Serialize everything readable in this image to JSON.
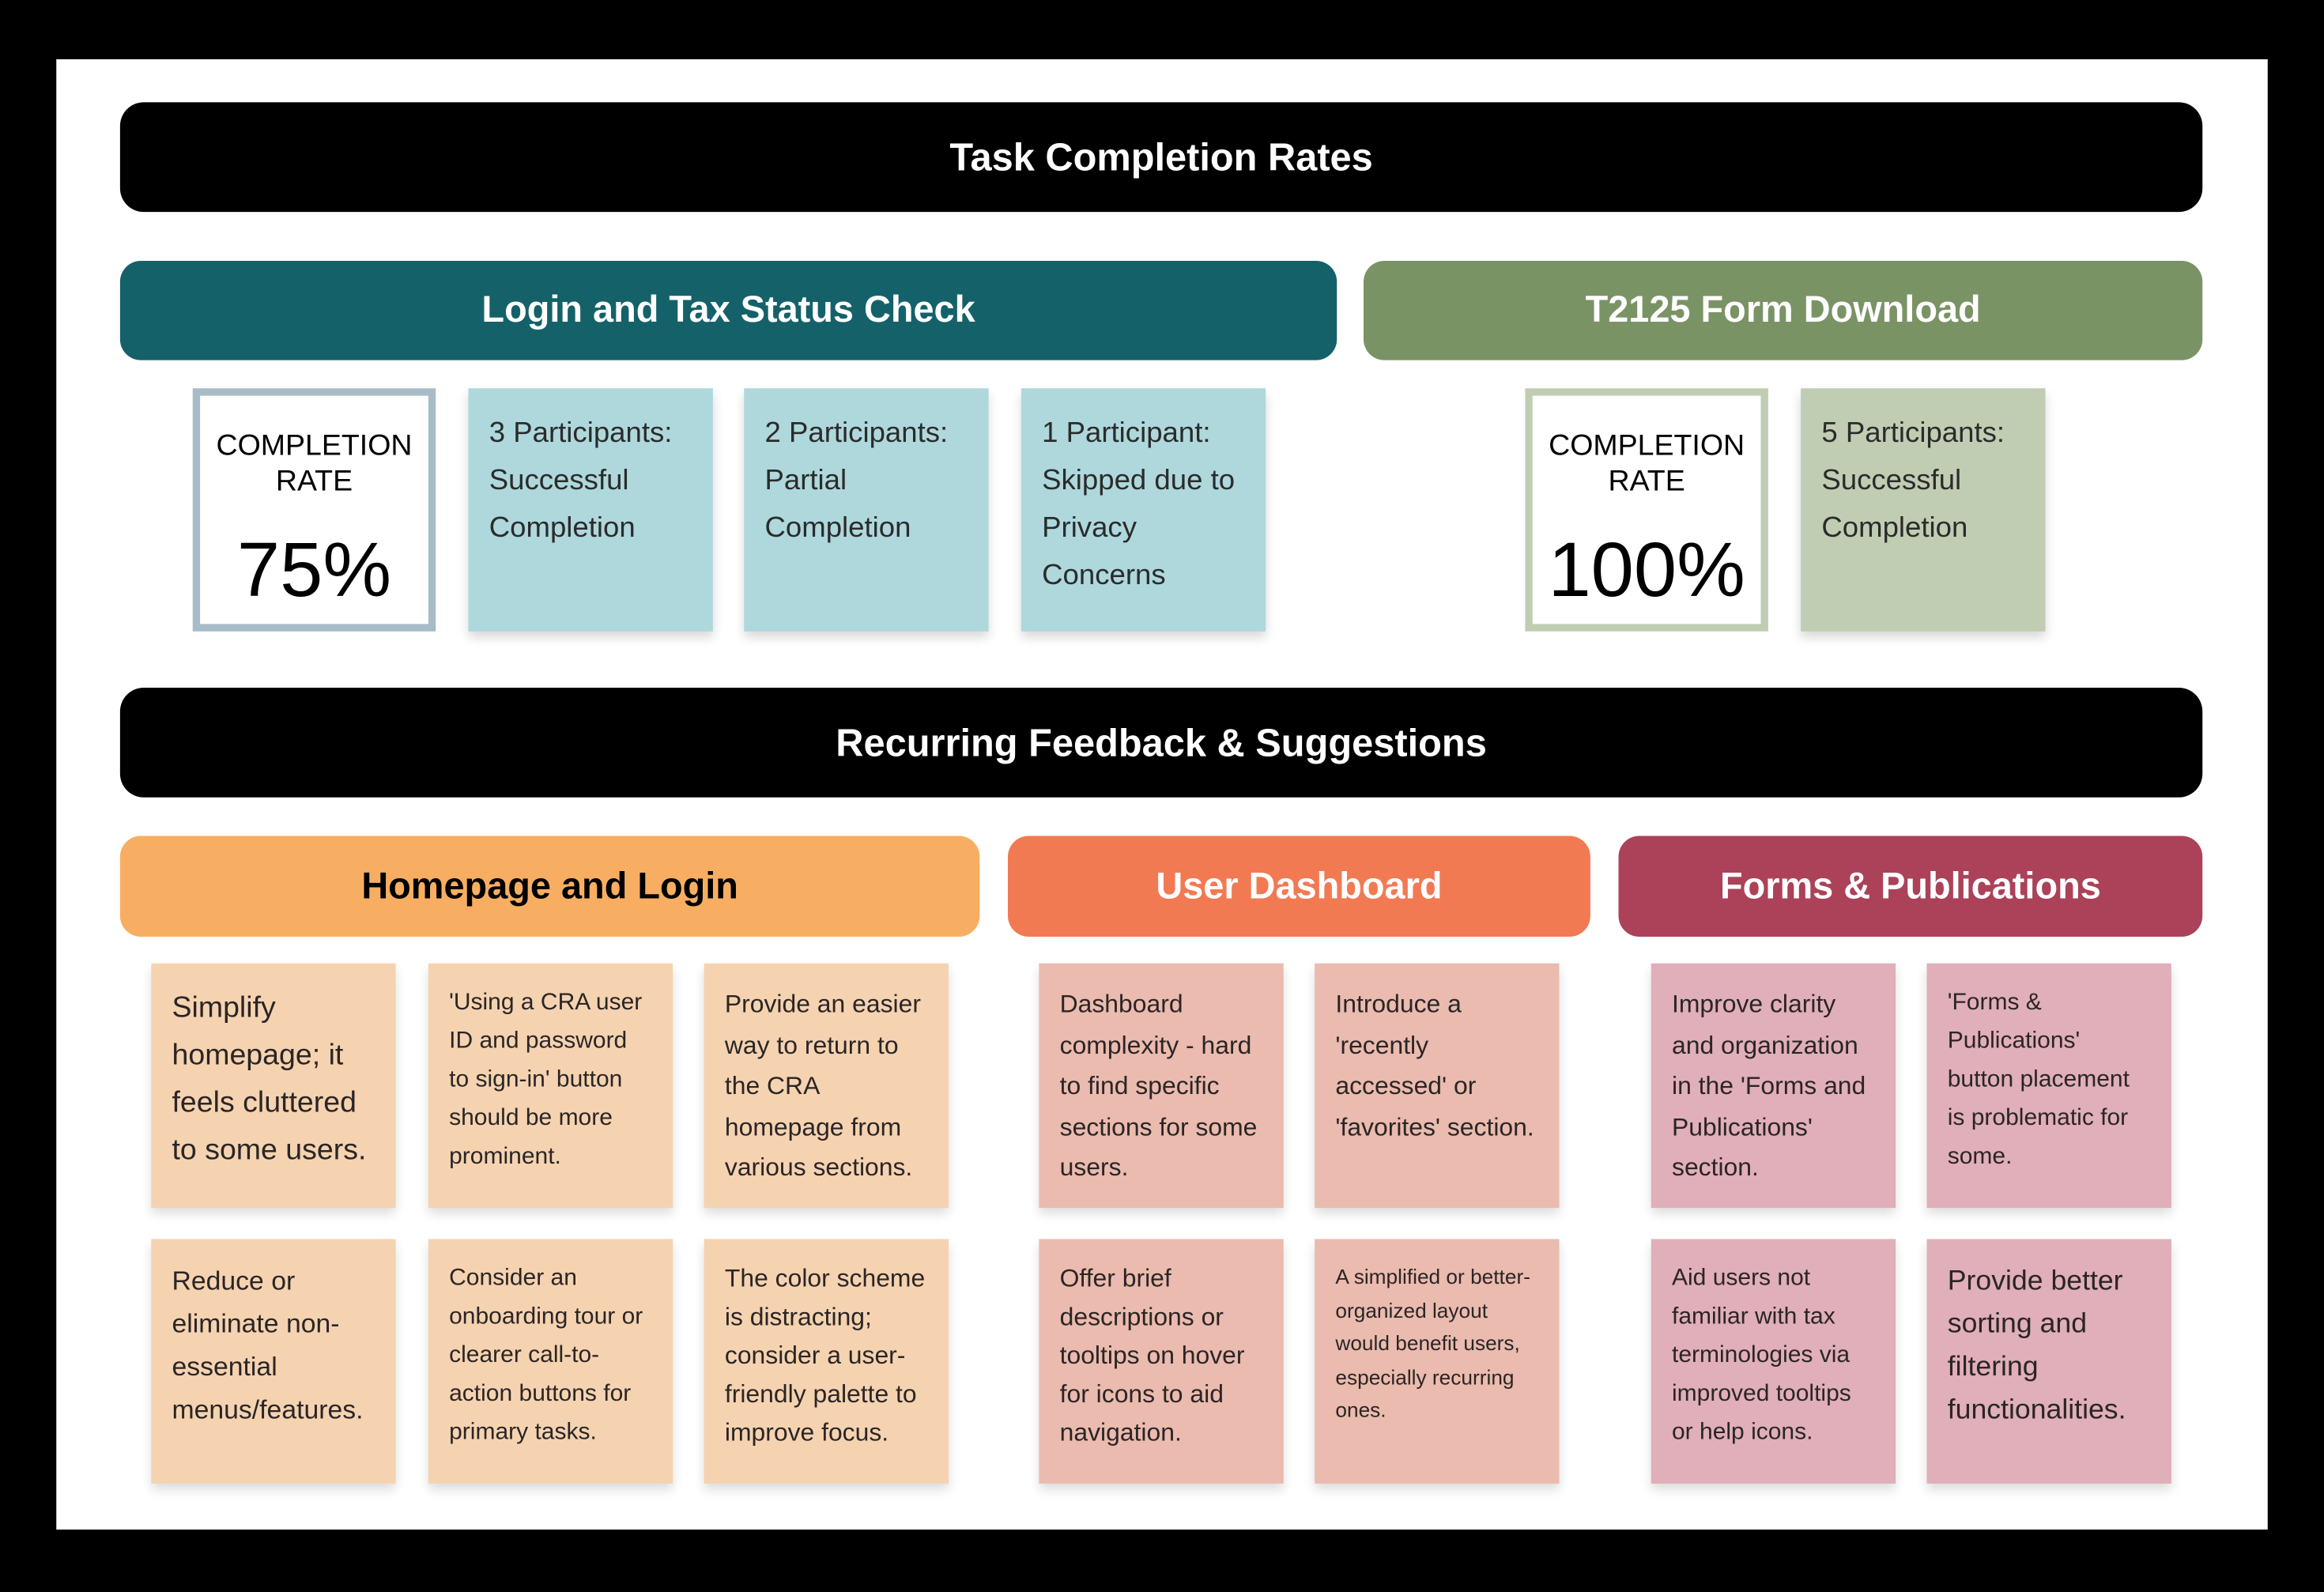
{
  "colors": {
    "frame": "#000000",
    "canvas": "#ffffff",
    "title_bar": "#000000",
    "login_header": "#15616a",
    "t2125_header": "#7a9365",
    "login_card": "#aed8dc",
    "login_stat_border": "#a7bcc7",
    "t2125_card": "#c0cdb2",
    "t2125_stat_border": "#c0cdb2",
    "homepage_header": "#f8ae62",
    "homepage_sticky": "#f5d3b1",
    "dashboard_header": "#f27a53",
    "dashboard_sticky": "#eabbae",
    "forms_header": "#ab4259",
    "forms_sticky": "#e0afb9"
  },
  "title": "Task Completion Rates",
  "tasks": [
    {
      "name": "Login and Tax Status Check",
      "completion_label": "COMPLETION RATE",
      "completion_label_line1": "COMPLETION",
      "completion_label_line2": "RATE",
      "completion_rate": "75%",
      "completion_fraction": 0.75,
      "cards": [
        "3 Participants: Successful Completion",
        "2 Participants: Partial Completion",
        "1 Participant: Skipped due to Privacy Concerns"
      ]
    },
    {
      "name": "T2125 Form Download",
      "completion_label": "COMPLETION RATE",
      "completion_label_line1": "COMPLETION",
      "completion_label_line2": "RATE",
      "completion_rate": "100%",
      "completion_fraction": 1.0,
      "cards": [
        "5 Participants: Successful Completion"
      ]
    }
  ],
  "feedback_title": "Recurring Feedback & Suggestions",
  "categories": [
    {
      "name": "Homepage and Login",
      "notes": [
        "Simplify homepage; it feels cluttered to some users.",
        "'Using a CRA user ID and password to sign-in' button should be more prominent.",
        "Provide an easier way to return to the CRA homepage from various sections.",
        "Reduce or eliminate non-essential menus/features.",
        "Consider an onboarding tour or clearer call-to-action buttons for primary tasks.",
        "The color scheme is distracting; consider a user-friendly palette to improve focus."
      ]
    },
    {
      "name": "User Dashboard",
      "notes": [
        "Dashboard complexity - hard to find specific sections for some users.",
        "Introduce a 'recently accessed' or 'favorites' section.",
        "Offer brief descriptions or tooltips on hover for icons to aid navigation.",
        "A simplified or better-organized layout would benefit users, especially recurring ones."
      ]
    },
    {
      "name": "Forms & Publications",
      "notes": [
        "Improve clarity and organization in the 'Forms and Publications' section.",
        "'Forms & Publications' button placement is problematic for some.",
        "Aid users not familiar with tax terminologies via improved tooltips or help icons.",
        "Provide better sorting and filtering functionalities."
      ]
    }
  ]
}
